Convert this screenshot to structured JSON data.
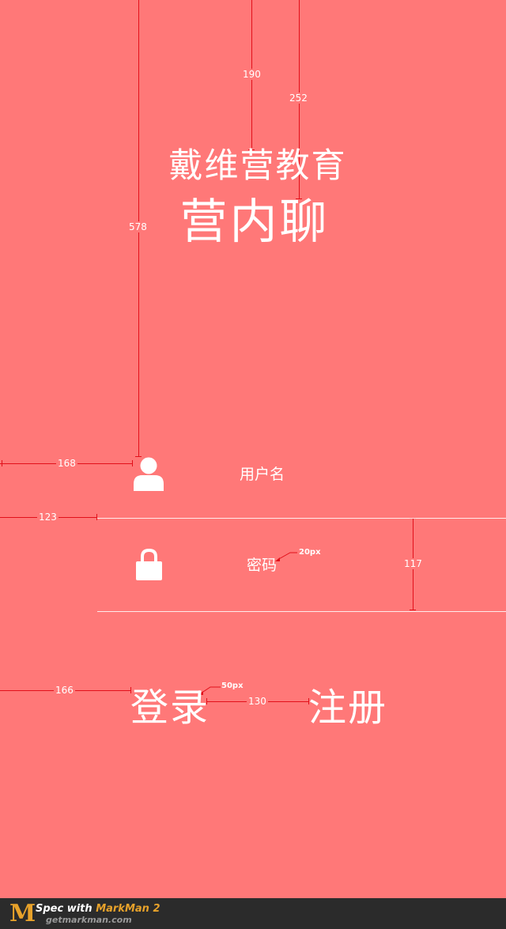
{
  "app": {
    "subtitle": "戴维营教育",
    "title": "营内聊"
  },
  "form": {
    "username_label": "用户名",
    "password_label": "密码",
    "login_label": "登录",
    "register_label": "注册"
  },
  "annotations": {
    "m190": "190",
    "m252": "252",
    "m578": "578",
    "m168": "168",
    "m123": "123",
    "m117": "117",
    "m166": "166",
    "m130": "130",
    "font20": "20px",
    "font50": "50px"
  },
  "footer": {
    "logo_letter": "M",
    "spec_prefix": "Spec with ",
    "brand": "MarkMan 2",
    "url": "getmarkman.com"
  },
  "colors": {
    "background": "#ff7878",
    "annotation": "#e2101a",
    "text": "#ffffff",
    "footer_bg": "#2b2b2b",
    "brand": "#e8a22a"
  },
  "icons": {
    "username": "user-icon",
    "password": "lock-icon"
  }
}
